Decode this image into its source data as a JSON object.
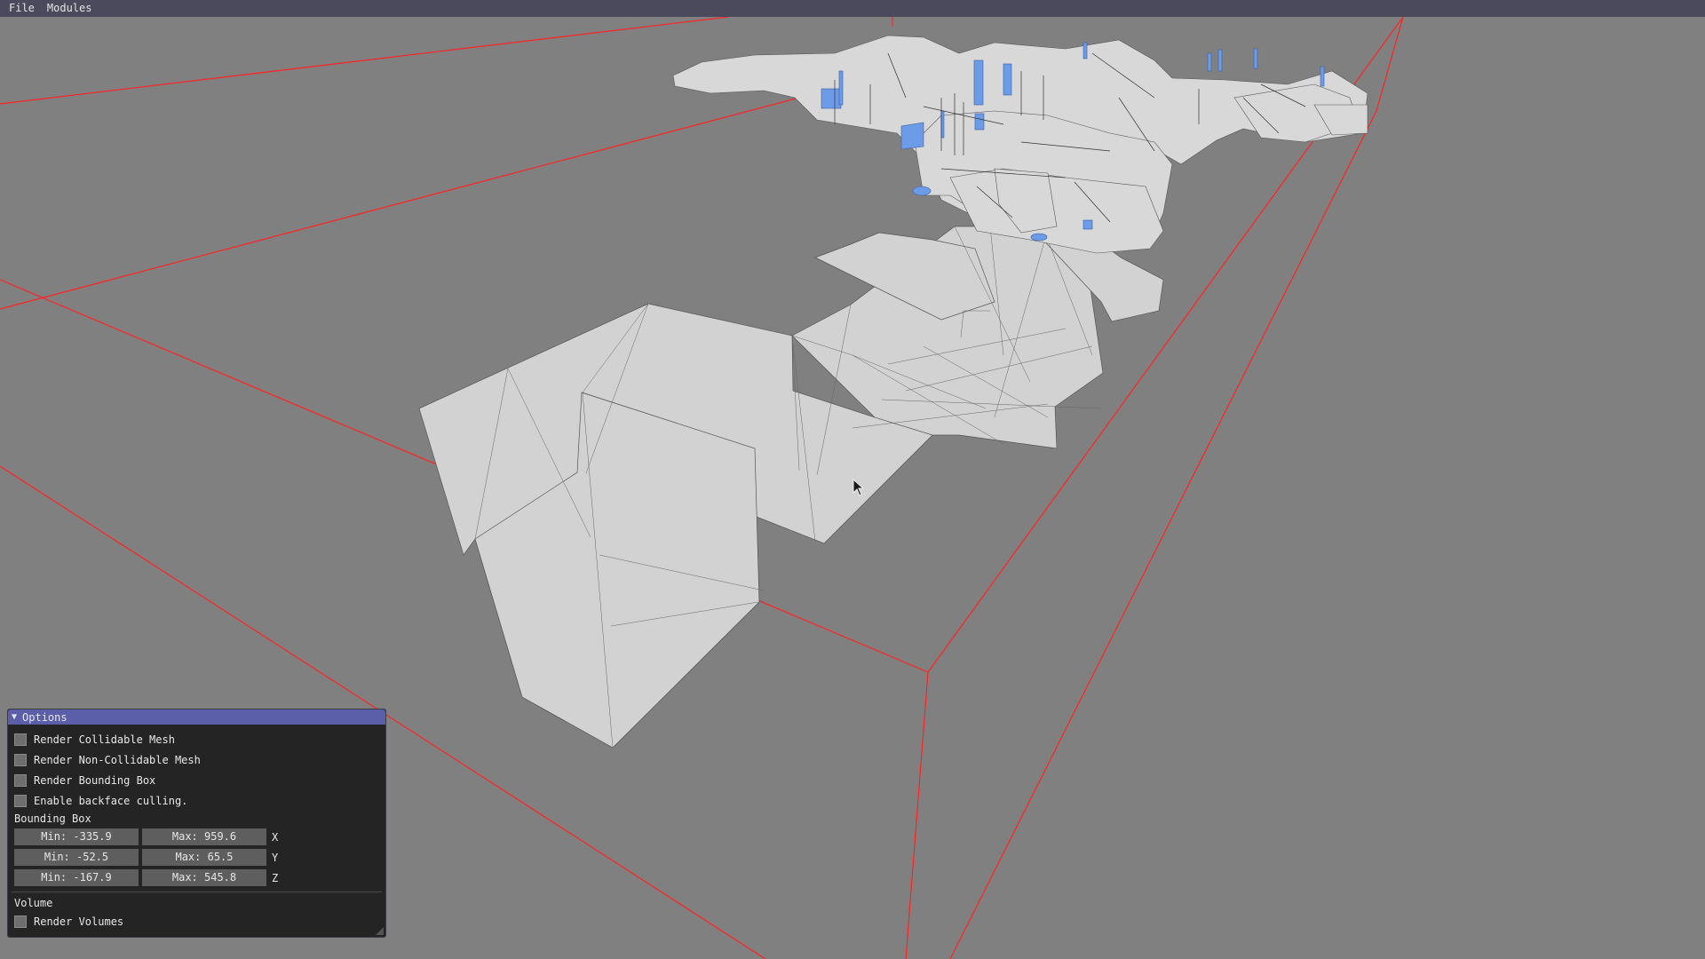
{
  "menu": {
    "file": "File",
    "modules": "Modules"
  },
  "options_panel": {
    "title": "Options",
    "checkboxes": [
      {
        "label": "Render Collidable Mesh",
        "checked": false
      },
      {
        "label": "Render Non-Collidable Mesh",
        "checked": false
      },
      {
        "label": "Render Bounding Box",
        "checked": false
      },
      {
        "label": "Enable backface culling.",
        "checked": false
      }
    ],
    "bounding_box": {
      "label": "Bounding Box",
      "x": {
        "min": "Min: -335.9",
        "max": "Max: 959.6",
        "axis": "X"
      },
      "y": {
        "min": "Min: -52.5",
        "max": "Max: 65.5",
        "axis": "Y"
      },
      "z": {
        "min": "Min: -167.9",
        "max": "Max: 545.8",
        "axis": "Z"
      }
    },
    "volume": {
      "label": "Volume",
      "render_volumes": {
        "label": "Render Volumes",
        "checked": false
      }
    }
  },
  "colors": {
    "background": "#808080",
    "bbox_lines": "#ff2020",
    "mesh_fill": "#d2d2d2",
    "mesh_accent": "#6c9ce8",
    "panel_title": "#5b5ea8"
  }
}
